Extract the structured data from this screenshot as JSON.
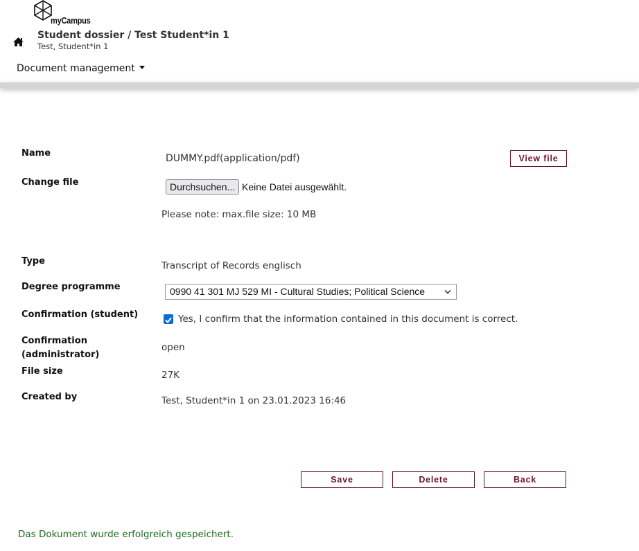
{
  "header": {
    "logo_text": "myCampus",
    "home_icon": "home-icon",
    "title": "Student dossier  / Test Student*in 1",
    "subtitle": "Test, Student*in 1",
    "menu_label": "Document management"
  },
  "form": {
    "name_label": "Name",
    "name_value": "DUMMY.pdf(application/pdf)",
    "view_file_button": "View file",
    "change_file_label": "Change file",
    "browse_button": "Durchsuchen...",
    "no_file_text": "Keine Datei ausgewählt.",
    "max_size_note": "Please note: max.file size: 10 MB",
    "type_label": "Type",
    "type_value": "Transcript of Records englisch",
    "degree_label": "Degree programme",
    "degree_selected": "0990 41 301 MJ 529 MI - Cultural Studies; Political Science",
    "confirm_student_label": "Confirmation (student)",
    "confirm_student_checked": true,
    "confirm_student_text": "Yes, I confirm that the information contained in this document is correct.",
    "confirm_admin_label_line1": "Confirmation",
    "confirm_admin_label_line2": "(administrator)",
    "confirm_admin_value": "open",
    "file_size_label": "File size",
    "file_size_value": "27K",
    "created_by_label": "Created by",
    "created_by_value": "Test, Student*in 1 on 23.01.2023 16:46"
  },
  "actions": {
    "save": "Save",
    "delete": "Delete",
    "back": "Back"
  },
  "status_message": "Das Dokument wurde erfolgreich gespeichert.",
  "colors": {
    "button_border": "#5a1230",
    "button_text": "#6d1233",
    "success_text": "#1e6b1e",
    "checkbox": "#0b6bd6"
  }
}
